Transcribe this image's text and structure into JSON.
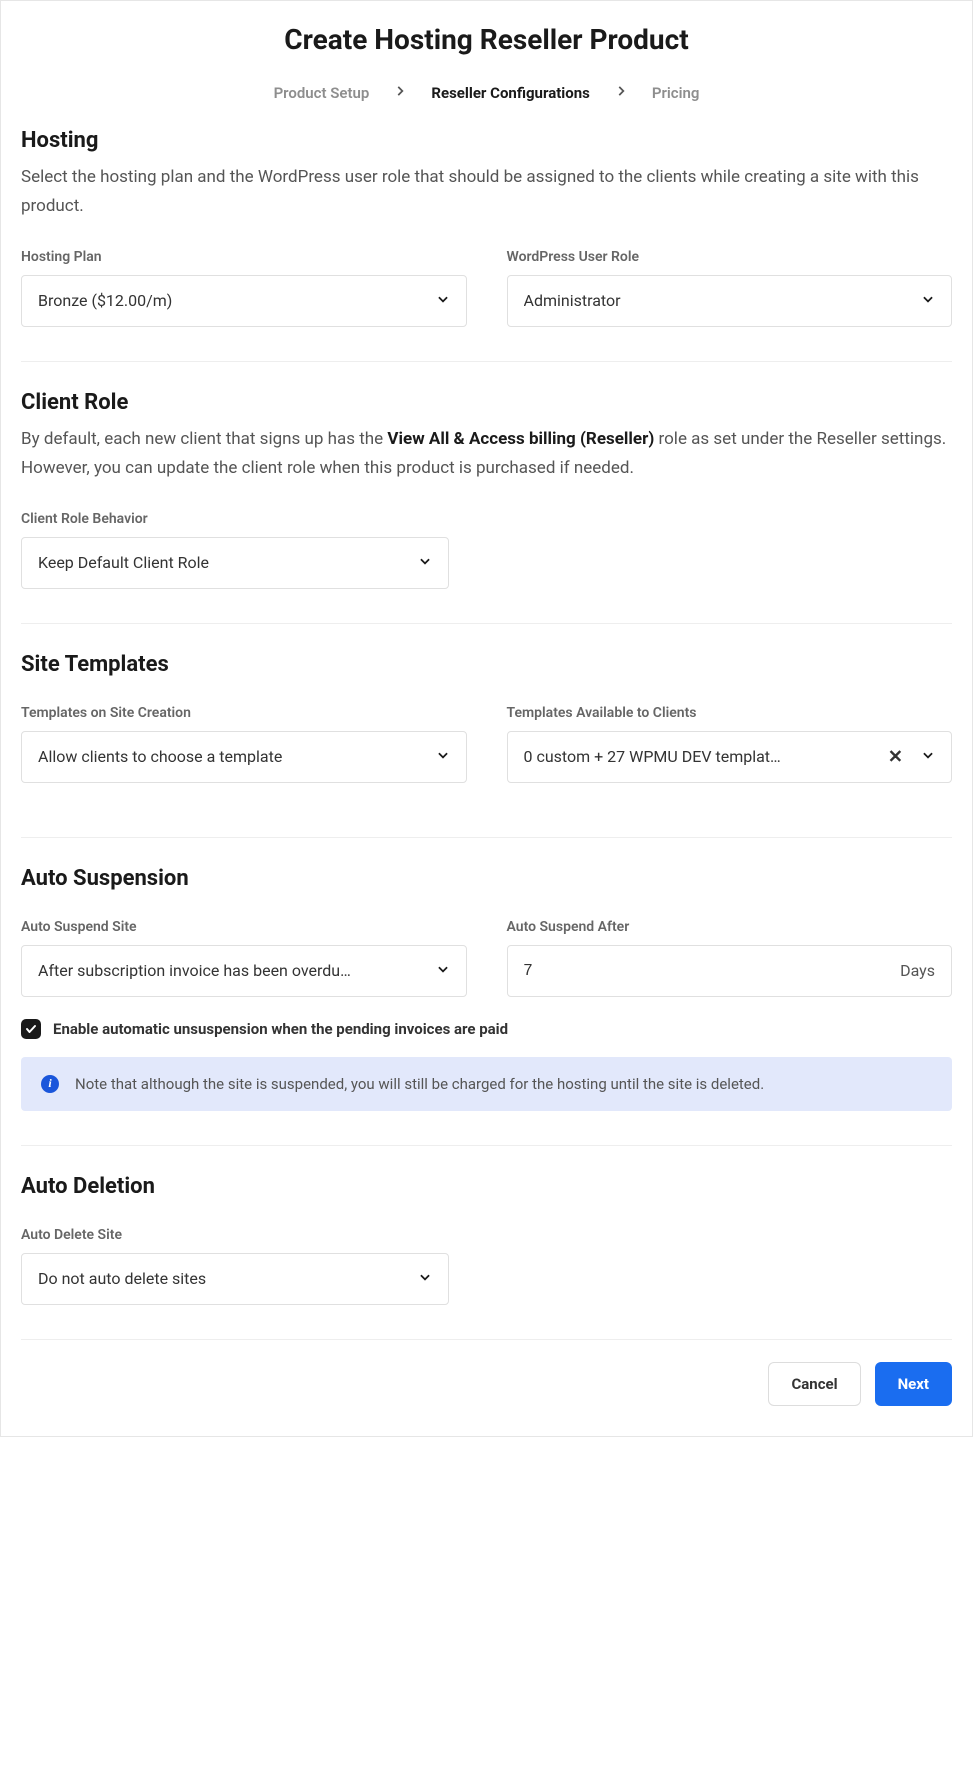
{
  "title": "Create Hosting Reseller Product",
  "breadcrumb": {
    "step1": "Product Setup",
    "step2": "Reseller Configurations",
    "step3": "Pricing"
  },
  "hosting": {
    "title": "Hosting",
    "desc": "Select the hosting plan and the WordPress user role that should be assigned to the clients while creating a site with this product.",
    "plan_label": "Hosting Plan",
    "plan_value": "Bronze ($12.00/m)",
    "role_label": "WordPress User Role",
    "role_value": "Administrator"
  },
  "client_role": {
    "title": "Client Role",
    "desc_pre": "By default, each new client that signs up has the ",
    "desc_bold": "View All & Access billing (Reseller)",
    "desc_post": " role as set under the Reseller settings. However, you can update the client role when this product is purchased if needed.",
    "behavior_label": "Client Role Behavior",
    "behavior_value": "Keep Default Client Role"
  },
  "site_templates": {
    "title": "Site Templates",
    "creation_label": "Templates on Site Creation",
    "creation_value": "Allow clients to choose a template",
    "available_label": "Templates Available to Clients",
    "available_value": "0 custom + 27 WPMU DEV templat…"
  },
  "auto_suspension": {
    "title": "Auto Suspension",
    "site_label": "Auto Suspend Site",
    "site_value": "After subscription invoice has been overdu…",
    "after_label": "Auto Suspend After",
    "after_value": "7",
    "after_suffix": "Days",
    "checkbox_label": "Enable automatic unsuspension when the pending invoices are paid",
    "note": "Note that although the site is suspended, you will still be charged for the hosting until the site is deleted."
  },
  "auto_deletion": {
    "title": "Auto Deletion",
    "site_label": "Auto Delete Site",
    "site_value": "Do not auto delete sites"
  },
  "footer": {
    "cancel": "Cancel",
    "next": "Next"
  }
}
